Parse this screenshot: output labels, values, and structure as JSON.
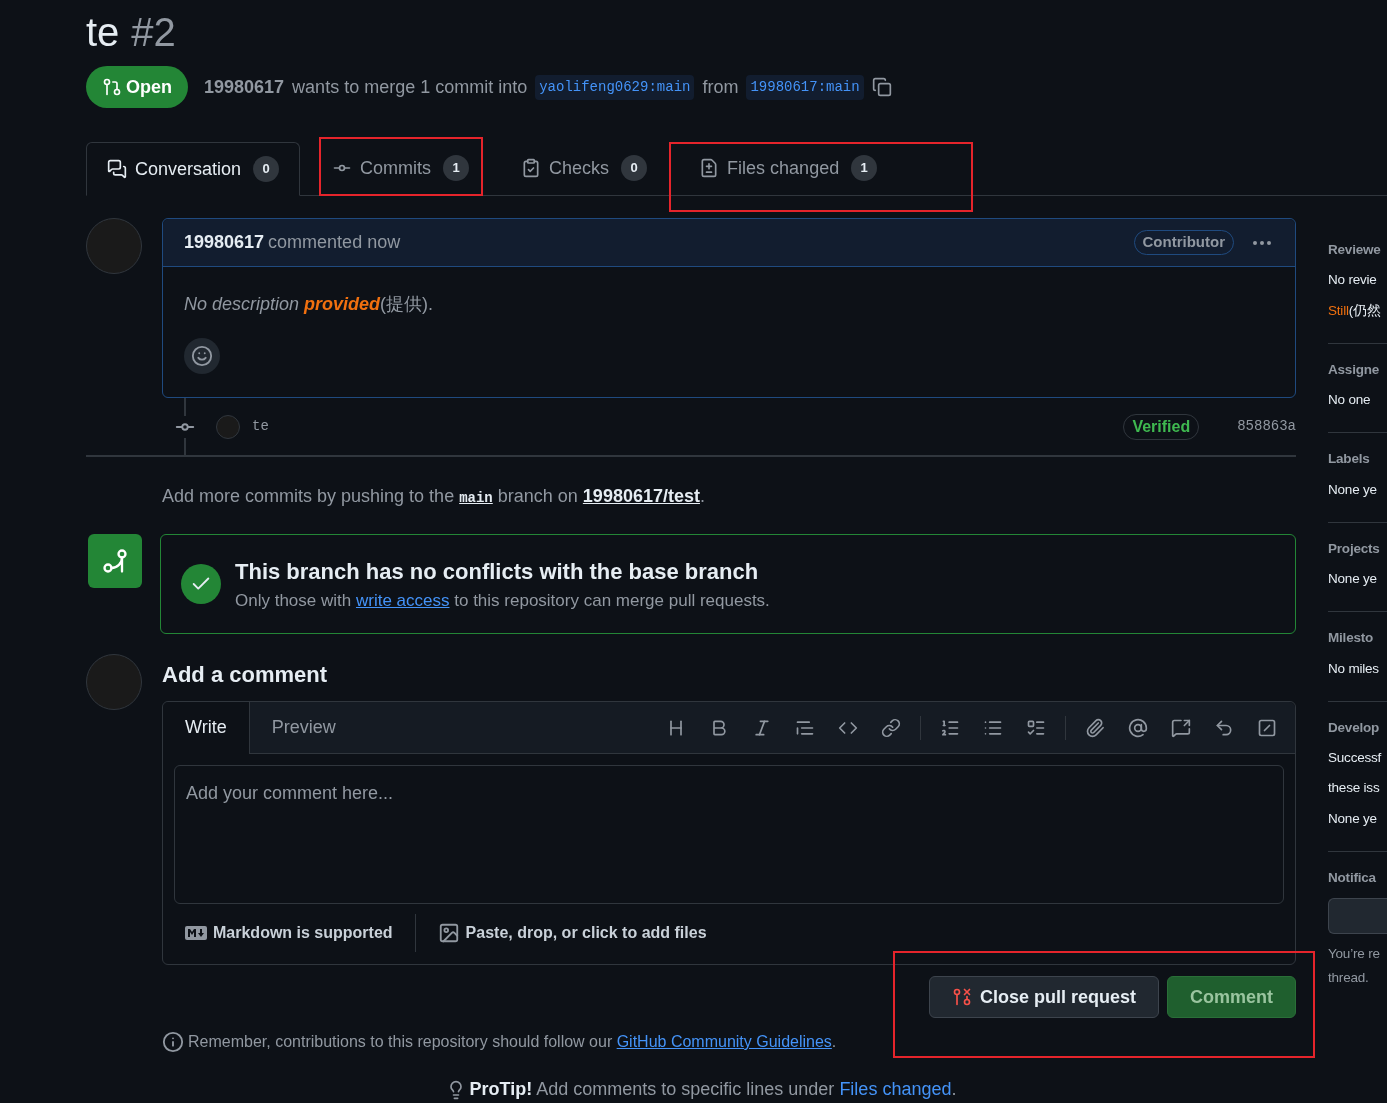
{
  "pr": {
    "title": "te",
    "number": "#2",
    "state": "Open",
    "author": "19980617",
    "summary": "wants to merge 1 commit into",
    "base": "yaolifeng0629:main",
    "from": "from",
    "head": "19980617:main"
  },
  "tabs": [
    {
      "label": "Conversation",
      "count": "0",
      "selected": true
    },
    {
      "label": "Commits",
      "count": "1",
      "selected": false
    },
    {
      "label": "Checks",
      "count": "0",
      "selected": false
    },
    {
      "label": "Files changed",
      "count": "1",
      "selected": false
    }
  ],
  "comment": {
    "author": "19980617",
    "action": "commented now",
    "badge": "Contributor",
    "body_start": "No description ",
    "body_highlight": "provided",
    "body_end": "(提供)."
  },
  "commit": {
    "message": "te",
    "verified": "Verified",
    "sha": "858863a"
  },
  "push_hint": {
    "before": "Add more commits by pushing to the",
    "branch": "main",
    "middle": "branch on",
    "repo": "19980617/test",
    "end": "."
  },
  "merge": {
    "title": "This branch has no conflicts with the base branch",
    "before": "Only those with",
    "link": "write access",
    "after": "to this repository can merge pull requests."
  },
  "add_comment": {
    "heading": "Add a comment",
    "tabs": [
      {
        "label": "Write",
        "selected": true
      },
      {
        "label": "Preview",
        "selected": false
      }
    ],
    "placeholder": "Add your comment here...",
    "markdown": "Markdown is supported",
    "attach": "Paste, drop, or click to add files"
  },
  "buttons": {
    "close": "Close pull request",
    "comment": "Comment"
  },
  "remember": {
    "text": "Remember, contributions to this repository should follow our",
    "link": "GitHub Community Guidelines",
    "end": "."
  },
  "protip": {
    "label": "ProTip!",
    "text": "Add comments to specific lines under",
    "link": "Files changed",
    "end": "."
  },
  "sidebar": [
    {
      "heading": "Reviewe",
      "lines": [
        {
          "text": "No revie"
        },
        {
          "highlight": "Still",
          "text": "(仍然"
        }
      ]
    },
    {
      "heading": "Assigne",
      "lines": [
        {
          "text": "No one"
        }
      ]
    },
    {
      "heading": "Labels",
      "lines": [
        {
          "text": "None ye"
        }
      ]
    },
    {
      "heading": "Projects",
      "lines": [
        {
          "text": "None ye"
        }
      ]
    },
    {
      "heading": "Milesto",
      "lines": [
        {
          "text": "No miles"
        }
      ]
    },
    {
      "heading": "Develop",
      "lines": [
        {
          "text": "Successf"
        },
        {
          "text": "these iss"
        },
        {
          "text": "None ye"
        }
      ]
    },
    {
      "heading": "Notifica",
      "button": true,
      "lines": [
        {
          "text": "You’re re"
        },
        {
          "text": "thread."
        }
      ]
    }
  ]
}
